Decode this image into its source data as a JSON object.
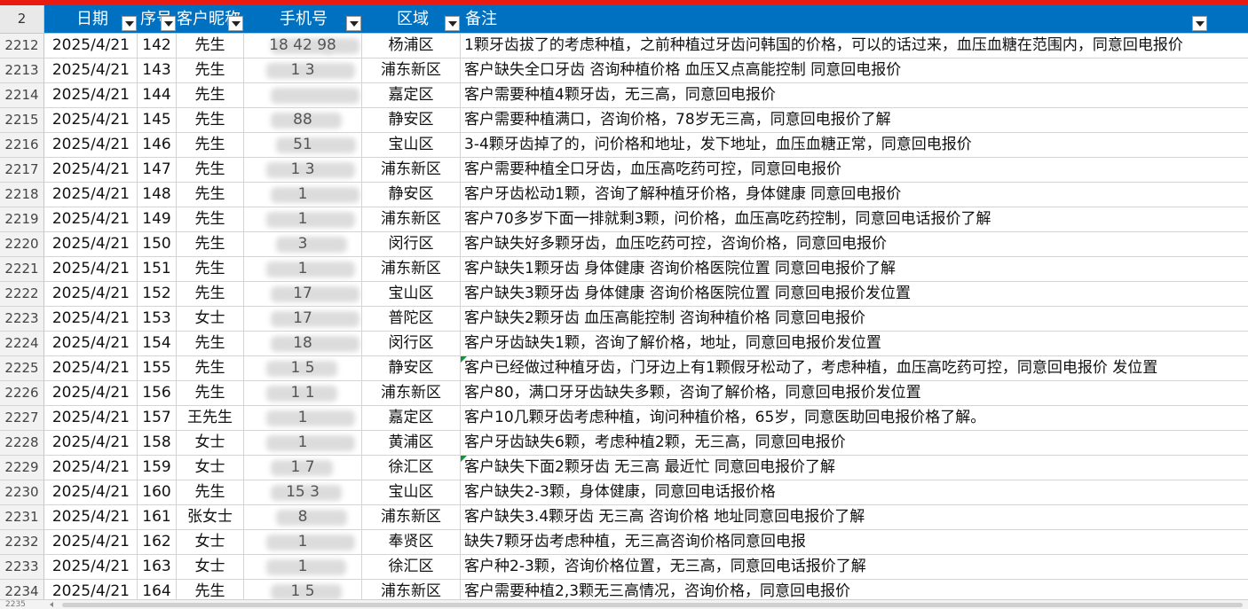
{
  "colors": {
    "top_accent": "#e81a12",
    "header_bg": "#0070c0",
    "green_marker": "#1e8c3a"
  },
  "header": {
    "row_number": "2",
    "columns": {
      "date": "日期",
      "seq": "序号",
      "name": "客户昵称",
      "phone": "手机号",
      "area": "区域",
      "note": "备注"
    }
  },
  "rows": [
    {
      "rn": "2212",
      "date": "2025/4/21",
      "seq": "142",
      "name": "先生",
      "phone_visible": "18  42  98",
      "area": "杨浦区",
      "note": "1颗牙齿拔了的考虑种植，之前种植过牙齿问韩国的价格，可以的话过来，血压血糖在范围内，同意回电报价",
      "marker": false
    },
    {
      "rn": "2213",
      "date": "2025/4/21",
      "seq": "143",
      "name": "先生",
      "phone_visible": "1  3",
      "area": "浦东新区",
      "note": "客户缺失全口牙齿 咨询种植价格 血压又点高能控制  同意回电报价",
      "marker": false
    },
    {
      "rn": "2214",
      "date": "2025/4/21",
      "seq": "144",
      "name": "先生",
      "phone_visible": "",
      "area": "嘉定区",
      "note": "客户需要种植4颗牙齿，无三高，同意回电报价",
      "marker": false
    },
    {
      "rn": "2215",
      "date": "2025/4/21",
      "seq": "145",
      "name": "先生",
      "phone_visible": "88",
      "area": "静安区",
      "note": "客户需要种植满口，咨询价格，78岁无三高，同意回电报价了解",
      "marker": false
    },
    {
      "rn": "2216",
      "date": "2025/4/21",
      "seq": "146",
      "name": "先生",
      "phone_visible": "51",
      "area": "宝山区",
      "note": "3-4颗牙齿掉了的，问价格和地址，发下地址，血压血糖正常，同意回电报价",
      "marker": false
    },
    {
      "rn": "2217",
      "date": "2025/4/21",
      "seq": "147",
      "name": "先生",
      "phone_visible": "1  3",
      "area": "浦东新区",
      "note": "客户需要种植全口牙齿，血压高吃药可控，同意回电报价",
      "marker": false
    },
    {
      "rn": "2218",
      "date": "2025/4/21",
      "seq": "148",
      "name": "先生",
      "phone_visible": "1",
      "area": "静安区",
      "note": "客户牙齿松动1颗，咨询了解种植牙价格，身体健康 同意回电报价",
      "marker": false
    },
    {
      "rn": "2219",
      "date": "2025/4/21",
      "seq": "149",
      "name": "先生",
      "phone_visible": "1",
      "area": "浦东新区",
      "note": "客户70多岁下面一排就剩3颗，问价格，血压高吃药控制，同意回电话报价了解",
      "marker": false
    },
    {
      "rn": "2220",
      "date": "2025/4/21",
      "seq": "150",
      "name": "先生",
      "phone_visible": "3",
      "area": "闵行区",
      "note": "客户缺失好多颗牙齿，血压吃药可控，咨询价格，同意回电报价",
      "marker": false
    },
    {
      "rn": "2221",
      "date": "2025/4/21",
      "seq": "151",
      "name": "先生",
      "phone_visible": "1",
      "area": "浦东新区",
      "note": "客户缺失1颗牙齿  身体健康 咨询价格医院位置 同意回电报价了解",
      "marker": false
    },
    {
      "rn": "2222",
      "date": "2025/4/21",
      "seq": "152",
      "name": "先生",
      "phone_visible": "17",
      "area": "宝山区",
      "note": "客户缺失3颗牙齿  身体健康 咨询价格医院位置 同意回电报价发位置",
      "marker": false
    },
    {
      "rn": "2223",
      "date": "2025/4/21",
      "seq": "153",
      "name": "女士",
      "phone_visible": "17",
      "area": "普陀区",
      "note": "客户缺失2颗牙齿   血压高能控制 咨询种植价格  同意回电报价",
      "marker": false
    },
    {
      "rn": "2224",
      "date": "2025/4/21",
      "seq": "154",
      "name": "先生",
      "phone_visible": "18",
      "area": "闵行区",
      "note": "客户牙齿缺失1颗，咨询了解价格，地址，同意回电报价发位置",
      "marker": false
    },
    {
      "rn": "2225",
      "date": "2025/4/21",
      "seq": "155",
      "name": "先生",
      "phone_visible": "1  5",
      "area": "静安区",
      "note": " 客户已经做过种植牙齿，门牙边上有1颗假牙松动了，考虑种植，血压高吃药可控，同意回电报价  发位置",
      "marker": true
    },
    {
      "rn": "2226",
      "date": "2025/4/21",
      "seq": "156",
      "name": "先生",
      "phone_visible": "1  1",
      "area": "浦东新区",
      "note": "客户80，满口牙牙齿缺失多颗，咨询了解价格，同意回电报价发位置",
      "marker": false
    },
    {
      "rn": "2227",
      "date": "2025/4/21",
      "seq": "157",
      "name": "王先生",
      "phone_visible": "1",
      "area": "嘉定区",
      "note": "客户10几颗牙齿考虑种植，询问种植价格，65岁，同意医助回电报价格了解。",
      "marker": false
    },
    {
      "rn": "2228",
      "date": "2025/4/21",
      "seq": "158",
      "name": "女士",
      "phone_visible": "1",
      "area": "黄浦区",
      "note": "客户牙齿缺失6颗，考虑种植2颗，无三高，同意回电报价",
      "marker": false
    },
    {
      "rn": "2229",
      "date": "2025/4/21",
      "seq": "159",
      "name": "女士",
      "phone_visible": "1  7",
      "area": "徐汇区",
      "note": "客户缺失下面2颗牙齿 无三高 最近忙 同意回电报价了解",
      "marker": true
    },
    {
      "rn": "2230",
      "date": "2025/4/21",
      "seq": "160",
      "name": "先生",
      "phone_visible": "15  3",
      "area": "宝山区",
      "note": "客户缺失2-3颗，身体健康，同意回电话报价格",
      "marker": false
    },
    {
      "rn": "2231",
      "date": "2025/4/21",
      "seq": "161",
      "name": "张女士",
      "phone_visible": "8",
      "area": "浦东新区",
      "note": "客户缺失3.4颗牙齿 无三高 咨询价格 地址同意回电报价了解",
      "marker": false
    },
    {
      "rn": "2232",
      "date": "2025/4/21",
      "seq": "162",
      "name": "女士",
      "phone_visible": "1",
      "area": "奉贤区",
      "note": "缺失7颗牙齿考虑种植，无三高咨询价格同意回电报",
      "marker": false
    },
    {
      "rn": "2233",
      "date": "2025/4/21",
      "seq": "163",
      "name": "女士",
      "phone_visible": "1",
      "area": "徐汇区",
      "note": "客户种2-3颗，咨询价格位置，无三高，同意回电话报价了解",
      "marker": false
    },
    {
      "rn": "2234",
      "date": "2025/4/21",
      "seq": "164",
      "name": "先生",
      "phone_visible": "1  5",
      "area": "浦东新区",
      "note": "客户需要种植2,3颗无三高情况，咨询价格，同意回电报价",
      "marker": false
    }
  ],
  "partial_row_number": "2235"
}
